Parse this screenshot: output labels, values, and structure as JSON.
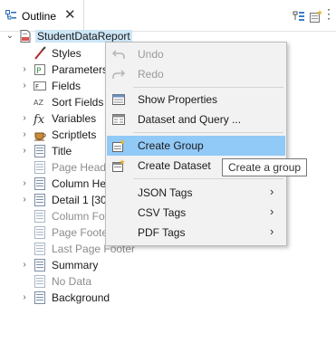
{
  "tab": {
    "title": "Outline",
    "close": "✕"
  },
  "toolbar": {
    "view_menu": "⋮"
  },
  "tree": {
    "root": "StudentDataReport",
    "nodes": [
      {
        "label": "Styles",
        "muted": false
      },
      {
        "label": "Parameters",
        "muted": false
      },
      {
        "label": "Fields",
        "muted": false
      },
      {
        "label": "Sort Fields",
        "muted": false
      },
      {
        "label": "Variables",
        "muted": false
      },
      {
        "label": "Scriptlets",
        "muted": false
      },
      {
        "label": "Title",
        "muted": false
      },
      {
        "label": "Page Heade",
        "muted": true
      },
      {
        "label": "Column He",
        "muted": false
      },
      {
        "label": "Detail 1 [30",
        "muted": false
      },
      {
        "label": "Column Fo",
        "muted": true
      },
      {
        "label": "Page Foote",
        "muted": true
      },
      {
        "label": "Last Page Footer",
        "muted": true
      },
      {
        "label": "Summary",
        "muted": false
      },
      {
        "label": "No Data",
        "muted": true
      },
      {
        "label": "Background",
        "muted": false
      }
    ]
  },
  "context_menu": {
    "undo": "Undo",
    "redo": "Redo",
    "show_properties": "Show Properties",
    "dataset_and_query": "Dataset and Query ...",
    "create_group": "Create Group",
    "create_dataset": "Create Dataset",
    "json_tags": "JSON Tags",
    "csv_tags": "CSV Tags",
    "pdf_tags": "PDF Tags",
    "submenu_arrow": "›"
  },
  "tooltip": "Create a group",
  "colors": {
    "selection": "#cde6f7",
    "menu_hover": "#91c9f7",
    "menu_bg": "#f2f2f2"
  }
}
